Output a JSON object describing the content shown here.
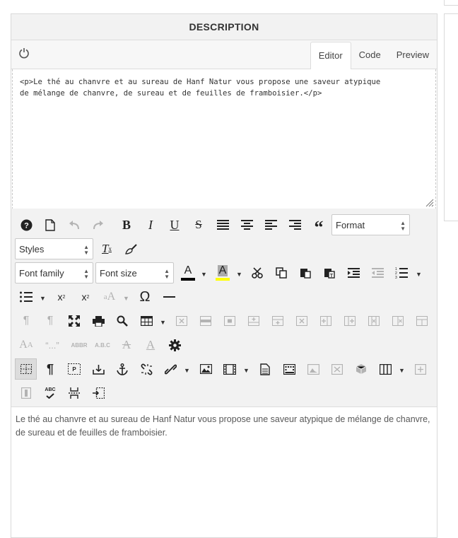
{
  "panel": {
    "title": "DESCRIPTION",
    "tabs": [
      {
        "label": "Editor",
        "active": true
      },
      {
        "label": "Code",
        "active": false
      },
      {
        "label": "Preview",
        "active": false
      }
    ]
  },
  "code_editor": {
    "content": "<p>Le thé au chanvre et au sureau de Hanf Natur vous propose une saveur atypique\nde mélange de chanvre, de sureau et de feuilles de framboisier.</p>"
  },
  "toolbar": {
    "format_select": "Format",
    "styles_select": "Styles",
    "font_family_select": "Font family",
    "font_size_select": "Font size",
    "text_color": "#000000",
    "bg_color": "#ffff00",
    "icons": [
      "help-icon",
      "new-document-icon",
      "undo-icon",
      "redo-icon",
      "bold-icon",
      "italic-icon",
      "underline-icon",
      "strikethrough-icon",
      "align-justify-icon",
      "align-center-icon",
      "align-left-icon",
      "align-right-icon",
      "blockquote-icon",
      "clear-format-icon",
      "format-painter-icon",
      "text-color-icon",
      "background-color-icon",
      "cut-icon",
      "copy-icon",
      "paste-icon",
      "paste-text-icon",
      "indent-icon",
      "outdent-icon",
      "numbered-list-icon",
      "bullet-list-icon",
      "subscript-icon",
      "superscript-icon",
      "font-size-icon",
      "omega-icon",
      "horizontal-rule-icon",
      "ltr-icon",
      "rtl-icon",
      "fullscreen-icon",
      "print-icon",
      "search-icon",
      "table-icon",
      "cell-icons",
      "abbr-icon",
      "abbr-abc-icon",
      "remove-format-icon",
      "font-a-icon",
      "settings-icon",
      "visual-blocks-icon",
      "pilcrow-icon",
      "paragraph-box-icon",
      "insert-icon",
      "anchor-icon",
      "unlink-icon",
      "link-icon",
      "image-icon",
      "media-icon",
      "template-icon",
      "layer-icon",
      "nonbreaking-icon",
      "cube-icon",
      "columns-icon",
      "spellcheck-icon",
      "pagebreak-icon"
    ]
  },
  "preview": {
    "text": "Le thé au chanvre et au sureau de Hanf Natur vous propose une saveur atypique de mélange de chanvre, de sureau et de feuilles de framboisier."
  }
}
